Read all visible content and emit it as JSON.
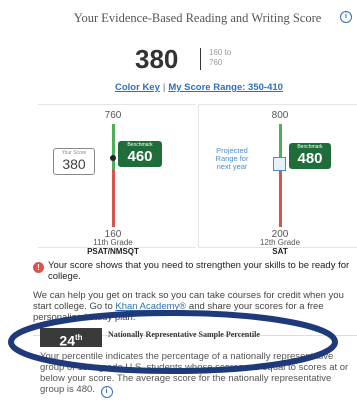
{
  "header": {
    "title": "Your Evidence-Based Reading and Writing Score",
    "score": "380",
    "range_line1": "160 to",
    "range_line2": "760",
    "color_key_link": "Color Key",
    "separator": "|",
    "score_range_link": "My Score Range: 350-410"
  },
  "psat_panel": {
    "max": "760",
    "min": "160",
    "your_score_label": "Your Score",
    "your_score": "380",
    "benchmark_label": "Benchmark",
    "benchmark": "460",
    "grade": "11th Grade",
    "test": "PSAT/NMSQT"
  },
  "sat_panel": {
    "max": "800",
    "min": "200",
    "projected_label": "Projected Range for next year",
    "benchmark_label": "Benchmark",
    "benchmark": "480",
    "grade": "12th Grade",
    "test": "SAT"
  },
  "alert": {
    "icon": "!",
    "text": "Your score shows that you need to strengthen your skills to be ready for college."
  },
  "help": {
    "text_before": "We can help you get on track so you can take courses for credit when you start college. Go to ",
    "link": "Khan Academy®",
    "text_after": " and share your scores for a free personalized study plan."
  },
  "percentile": {
    "number": "24",
    "suffix": "th",
    "title": "Nationally Representative Sample Percentile",
    "body": "Your percentile indicates the percentage of a nationally representative group of 11th-grade U.S. students whose scores are equal to scores at or below your score. The average score for the nationally representative group is 480."
  },
  "colors": {
    "benchmark_green": "#1f6e3a",
    "bar_green": "#4fae5a",
    "bar_red": "#d9534f",
    "link_blue": "#2f6fba",
    "projected_blue": "#4a8fd1",
    "ellipse": "#1e3a7a"
  }
}
